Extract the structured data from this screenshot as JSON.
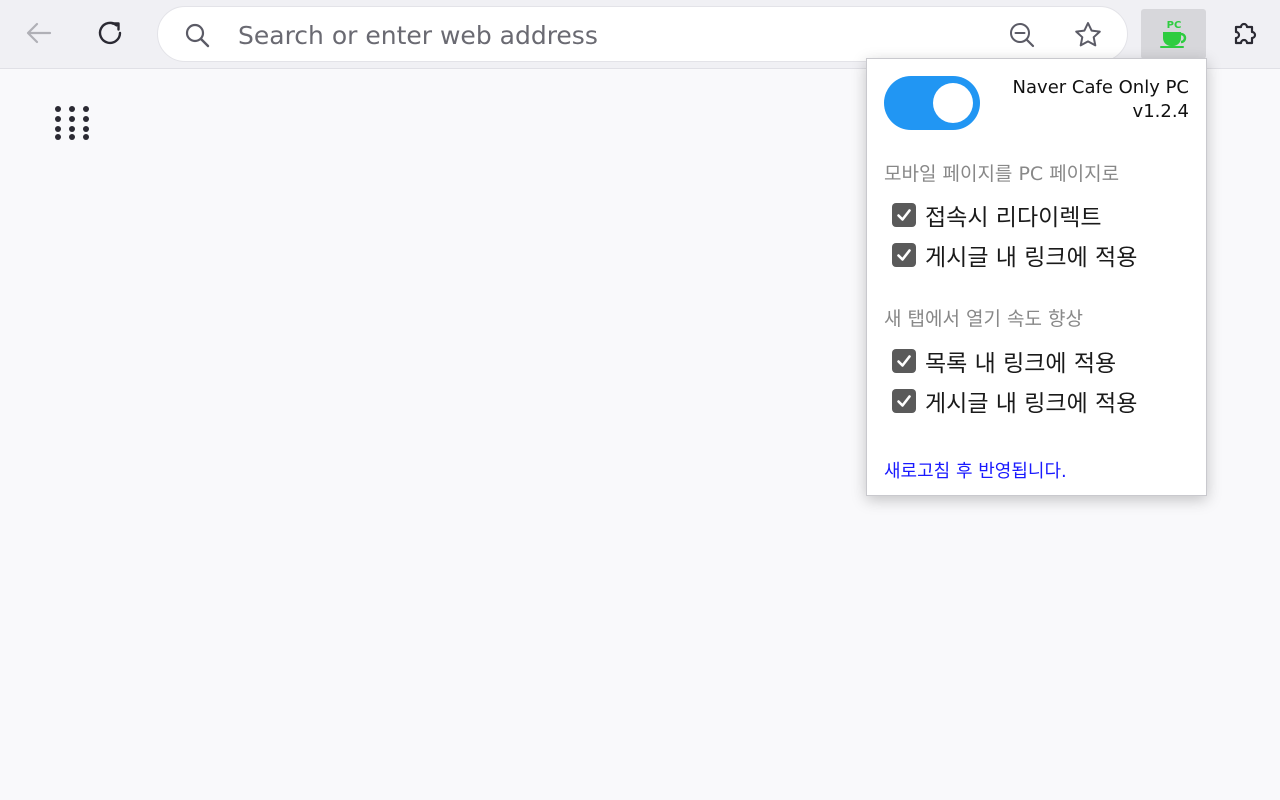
{
  "toolbar": {
    "back_icon": "arrow-left-icon",
    "reload_icon": "reload-icon",
    "urlbar": {
      "placeholder": "Search or enter web address",
      "value": ""
    },
    "extension_badge": "PC",
    "colors": {
      "extension_cup": "#2ecc40",
      "toolbar_bg": "#f0f0f4"
    }
  },
  "popup": {
    "toggle": {
      "state": "on",
      "color": "#2196f3"
    },
    "title_line1": "Naver Cafe Only PC",
    "title_line2": "v1.2.4",
    "section1": {
      "heading": "모바일 페이지를 PC 페이지로",
      "items": [
        {
          "label": "접속시 리다이렉트",
          "checked": true
        },
        {
          "label": "게시글 내 링크에 적용",
          "checked": true
        }
      ]
    },
    "section2": {
      "heading": "새 탭에서 열기 속도 향상",
      "items": [
        {
          "label": "목록 내 링크에 적용",
          "checked": true
        },
        {
          "label": "게시글 내 링크에 적용",
          "checked": true
        }
      ]
    },
    "footer_note": "새로고침 후 반영됩니다.",
    "footer_color": "#1a1aff"
  }
}
